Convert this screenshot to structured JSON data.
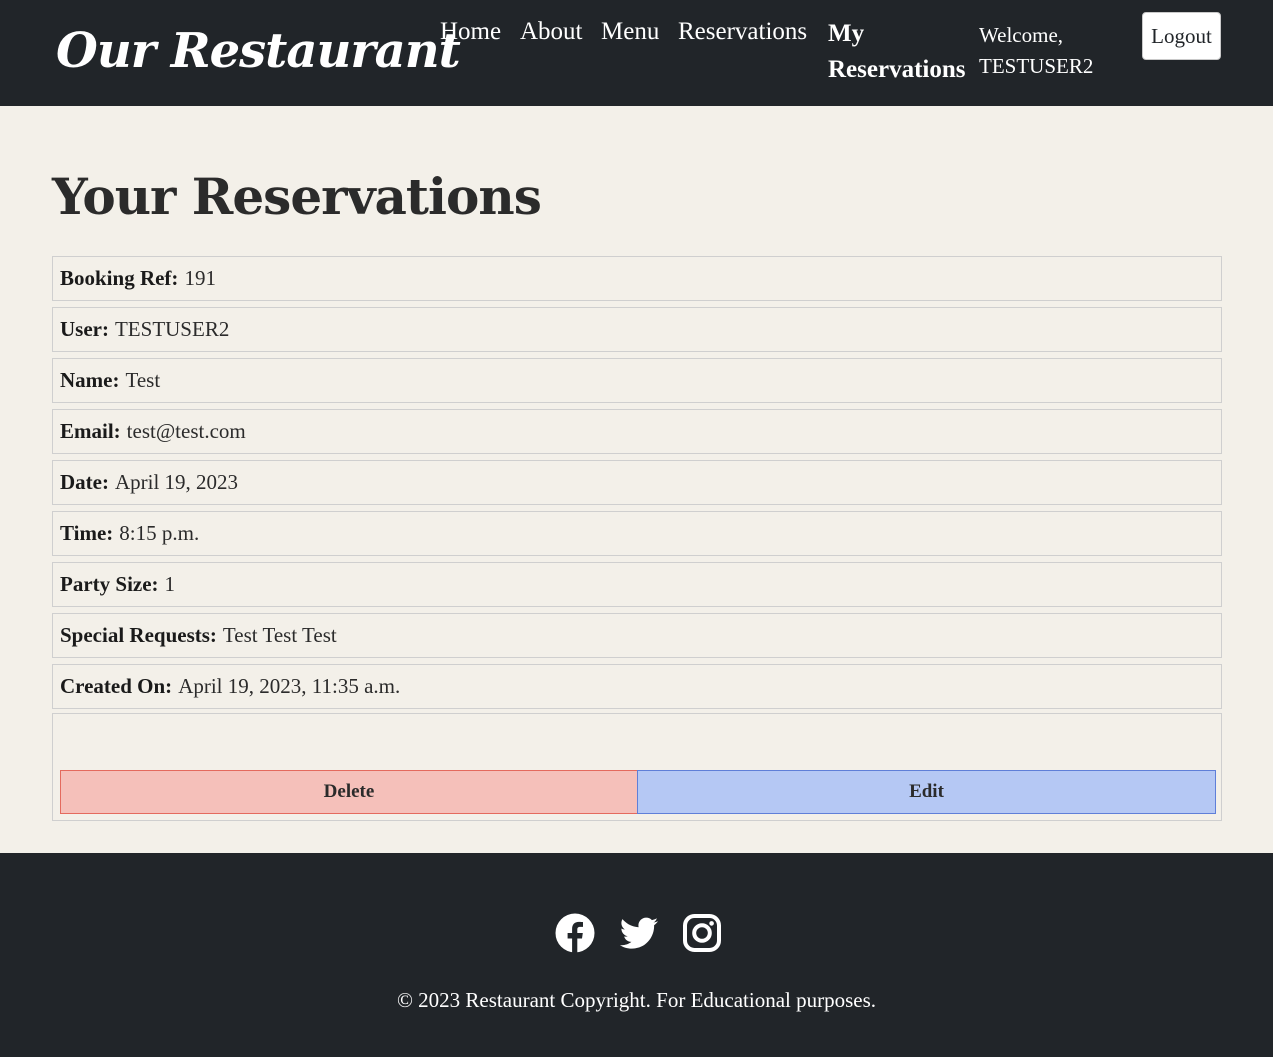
{
  "header": {
    "brand": "Our Restaurant",
    "nav": {
      "home": "Home",
      "about": "About",
      "menu": "Menu",
      "reservations": "Reservations",
      "my_reservations": "My Reservations"
    },
    "welcome": "Welcome, TESTUSER2",
    "logout_label": "Logout"
  },
  "main": {
    "title": "Your Reservations",
    "details": [
      {
        "label": "Booking Ref:",
        "value": "191"
      },
      {
        "label": "User:",
        "value": "TESTUSER2"
      },
      {
        "label": "Name:",
        "value": "Test"
      },
      {
        "label": "Email:",
        "value": "test@test.com"
      },
      {
        "label": "Date:",
        "value": "April 19, 2023"
      },
      {
        "label": "Time:",
        "value": "8:15 p.m."
      },
      {
        "label": "Party Size:",
        "value": "1"
      },
      {
        "label": "Special Requests:",
        "value": "Test Test Test"
      },
      {
        "label": "Created On:",
        "value": "April 19, 2023, 11:35 a.m."
      }
    ],
    "delete_label": "Delete",
    "edit_label": "Edit"
  },
  "footer": {
    "icons": [
      "facebook-icon",
      "twitter-icon",
      "instagram-icon"
    ],
    "copyright": "© 2023 Restaurant Copyright. For Educational purposes."
  },
  "colors": {
    "header_bg": "#212529",
    "page_bg": "#f3f0e9",
    "delete_bg": "#f5c0ba",
    "edit_bg": "#b5c8f4"
  }
}
